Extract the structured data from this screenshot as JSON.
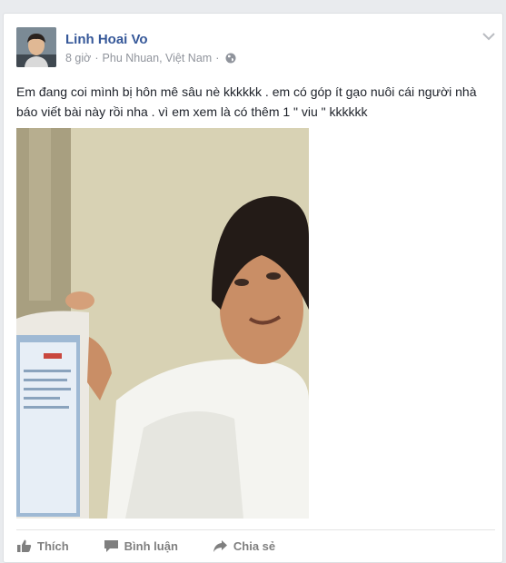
{
  "post": {
    "author": "Linh Hoai Vo",
    "time": "8 giờ",
    "separator": "·",
    "location": "Phu Nhuan, Việt Nam",
    "privacy_icon": "globe-icon",
    "text": "Em đang coi mình bị hôn mê sâu nè kkkkkk . em có góp ít gạo nuôi cái người nhà báo viết bài này rồi nha . vì em xem là có thêm 1 \" viu \" kkkkkk"
  },
  "actions": {
    "like": "Thích",
    "comment": "Bình luận",
    "share": "Chia sẻ"
  },
  "colors": {
    "author_link": "#365899",
    "meta_gray": "#90949c",
    "action_gray": "#7f7f7f"
  }
}
